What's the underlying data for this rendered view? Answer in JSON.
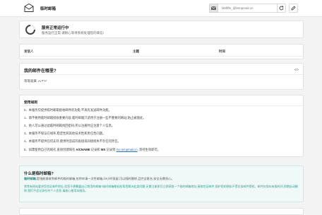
{
  "header": {
    "site_title": "临时邮箱",
    "address_placeholder": "lahfiffe_@tempmail.cn"
  },
  "status": {
    "title": "服务正常运行中",
    "subtitle": "服务运行正常,请耐心等待系统处理您的来信!"
  },
  "mail_table": {
    "columns": [
      "发信人",
      "主题",
      "时间"
    ]
  },
  "where": {
    "title": "我的邮件在哪里?",
    "code_icon": "</>",
    "waiting_text": "等等就来"
  },
  "rules": {
    "title": "使用规则",
    "items": [
      {
        "prefix": "0、本服务仅提供临时邮箱接收邮件的功能,不具有发送邮件功能。"
      },
      {
        "prefix": "1、请不要用临时邮箱接收重要内容,临时邮箱只适用于注册一些不重要的网站,防止被骚扰。"
      },
      {
        "prefix": "2、他人可以通过此临时邮箱找回密码,所以注册时应注意个人信息。"
      },
      {
        "prefix": "3、本服务不保证在线率,稳定性和其他技术性和责任性问题。"
      },
      {
        "prefix": "4、本服务不提供任何支持,使用时造成的直接或间接损失不负任何责任。"
      },
      {
        "prefix": "5、如需使用自己的域名,直接创建域名 ",
        "bold1": "A/CNAME",
        "mid1": " 记录和 ",
        "bold2": "MX",
        "mid2": " 记录到 ",
        "domain": "mx.tempmail.cn",
        "suffix": " ,等待生效即可。"
      }
    ]
  },
  "info": {
    "title": "什么是临时邮箱?",
    "highlight": "临时邮箱",
    "line1_rest": ":是指能够收到邮件的临时邮箱,仅供申请一次性邮箱,24小时保留,可以随时删除,且完全匿名,安全无需担心。",
    "line2": "常常有网站要求您验证邮件地址,而您不想暴露自己常用的邮箱?临时邮箱能轻松帮您解决此类问题,无需注册即可立即获取一个临时邮箱地址,接收验证邮件,保护您的隐私不受垃圾邮件侵扰。邮件仅保存有限时间,到期自动删除,我们不会记录任何个人信息,请放心使用本服务。"
  },
  "colors": {
    "accent_teal": "#2a9d8f",
    "link_blue": "#2a6ebb"
  }
}
